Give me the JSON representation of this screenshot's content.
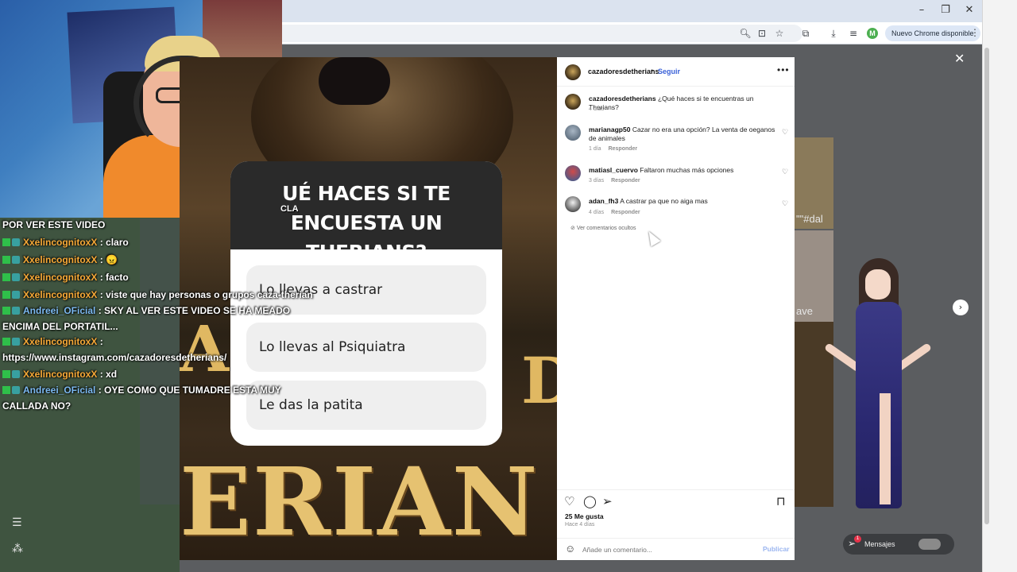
{
  "browser": {
    "window_controls": {
      "minimize": "–",
      "maximize": "❐",
      "close": "✕"
    },
    "toolbar_icons": [
      "zoom-icon",
      "install-icon",
      "star-icon",
      "extensions-icon",
      "download-icon",
      "reading-list-icon"
    ],
    "profile_initial": "M",
    "update_label": "Nuevo Chrome disponible",
    "menu_glyph": "⋮"
  },
  "stream_chat": {
    "top_line": "POR VER ESTE VIDEO",
    "messages": [
      {
        "user": "XxelincognitoxX",
        "text": " : claro",
        "wrap": false
      },
      {
        "user": "XxelincognitoxX",
        "text": " : 😠",
        "wrap": false
      },
      {
        "user": "XxelincognitoxX",
        "text": " : facto",
        "wrap": false
      },
      {
        "user": "XxelincognitoxX",
        "text": " : viste que hay personas o grupos caza-therian",
        "wrap": false
      },
      {
        "user": "Andreei_OFicial",
        "text": " : SKY AL VER ESTE VIDEO SE HA MEADO ENCIMA DEL PORTATIL...",
        "wrap": true
      },
      {
        "user": "XxelincognitoxX",
        "text": " : https://www.instagram.com/cazadoresdetherians/",
        "wrap": true
      },
      {
        "user": "XxelincognitoxX",
        "text": " : xd",
        "wrap": false
      },
      {
        "user": "Andreei_OFicial",
        "text": " : OYE COMO QUE TUMADRE ESTA MUY CALLADA NO?",
        "wrap": true
      }
    ]
  },
  "post_image": {
    "overlay_fragment": "CLA",
    "poll_question": "UÉ HACES SI TE ENCUESTA UN THERIANS?",
    "poll_options": [
      "Lo llevas a castrar",
      "Lo llevas al Psiquiatra",
      "Le das la patita"
    ],
    "big_letters": "ERIAN",
    "side_left": "A",
    "side_right": "D"
  },
  "background": {
    "tile_text_1": "\"\"#dal",
    "tile_text_2": "ave"
  },
  "post_panel": {
    "account": "cazadoresdetherians",
    "dot": "•",
    "follow_label": "Seguir",
    "more_glyph": "•••",
    "caption": {
      "user": "cazadoresdetherians",
      "text": " ¿Qué haces si te encuentras un Therians?",
      "time": "4 días"
    },
    "comments": [
      {
        "user": "marianagp50",
        "text": " Cazar no era una opción? La venta de oeganos de animales",
        "time": "1 día",
        "reply": "Responder"
      },
      {
        "user": "matiasl_cuervo",
        "text": " Faltaron muchas más opciones",
        "time": "3 días",
        "reply": "Responder"
      },
      {
        "user": "adan_fh3",
        "text": " A castrar pa que no aiga mas",
        "time": "4 días",
        "reply": "Responder"
      }
    ],
    "hidden_comments": "Ver comentarios ocultos",
    "likes": "25 Me gusta",
    "posted_ago": "Hace 4 días",
    "comment_placeholder": "Añade un comentario...",
    "publish_label": "Publicar"
  },
  "modal": {
    "close_glyph": "✕",
    "next_glyph": "›"
  },
  "sidebar_bottom": {
    "menu_glyph": "☰",
    "more_glyph": "⁂"
  },
  "messages_button": {
    "label": "Mensajes",
    "count": "1"
  }
}
